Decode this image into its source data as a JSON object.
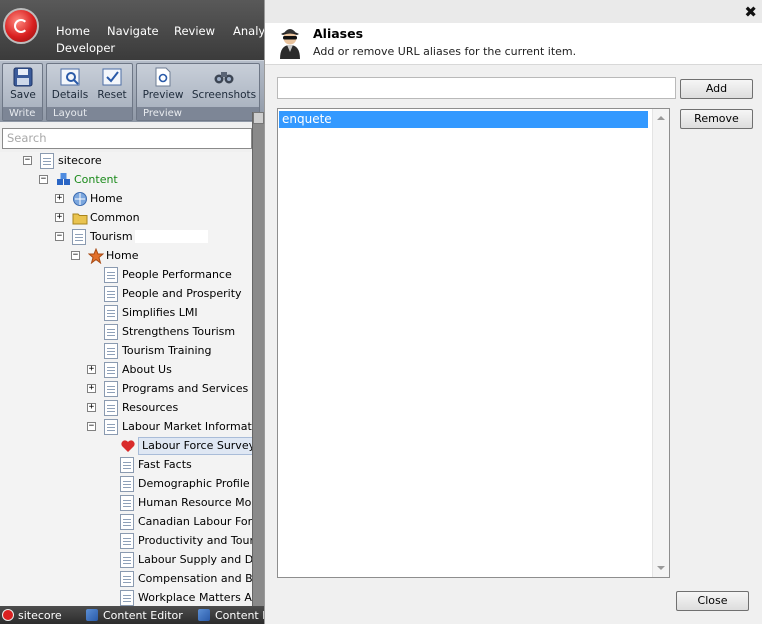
{
  "app": {
    "menu": [
      "Home",
      "Navigate",
      "Review",
      "Analy",
      "Developer"
    ],
    "ribbon": {
      "groups": [
        {
          "title": "Write",
          "buttons": [
            "Save"
          ]
        },
        {
          "title": "Layout",
          "buttons": [
            "Details",
            "Reset"
          ]
        },
        {
          "title": "Preview",
          "buttons": [
            "Preview",
            "Screenshots"
          ]
        }
      ]
    },
    "search_placeholder": "Search",
    "tree": [
      {
        "label": "sitecore",
        "level": 0,
        "toggle": "−",
        "icon": "doc"
      },
      {
        "label": "Content",
        "level": 1,
        "toggle": "−",
        "icon": "content",
        "color": "#1a8a1a"
      },
      {
        "label": "Home",
        "level": 2,
        "toggle": "+",
        "icon": "home"
      },
      {
        "label": "Common",
        "level": 2,
        "toggle": "+",
        "icon": "folder"
      },
      {
        "label": "Tourism",
        "level": 2,
        "toggle": "−",
        "icon": "doc"
      },
      {
        "label": "Home",
        "level": 3,
        "toggle": "−",
        "icon": "star"
      },
      {
        "label": "People Performance",
        "level": 4,
        "icon": "doc"
      },
      {
        "label": "People and Prosperity",
        "level": 4,
        "icon": "doc"
      },
      {
        "label": "Simplifies LMI",
        "level": 4,
        "icon": "doc"
      },
      {
        "label": "Strengthens Tourism",
        "level": 4,
        "icon": "doc"
      },
      {
        "label": "Tourism Training",
        "level": 4,
        "icon": "doc"
      },
      {
        "label": "About Us",
        "level": 4,
        "toggle": "+",
        "icon": "doc"
      },
      {
        "label": "Programs and Services",
        "level": 4,
        "toggle": "+",
        "icon": "doc"
      },
      {
        "label": "Resources",
        "level": 4,
        "toggle": "+",
        "icon": "doc"
      },
      {
        "label": "Labour Market Information",
        "level": 4,
        "toggle": "−",
        "icon": "doc"
      },
      {
        "label": "Labour Force Survey",
        "level": 5,
        "icon": "heart",
        "selected": true
      },
      {
        "label": "Fast Facts",
        "level": 5,
        "icon": "doc"
      },
      {
        "label": "Demographic Profile of",
        "level": 5,
        "icon": "doc"
      },
      {
        "label": "Human Resource Modu",
        "level": 5,
        "icon": "doc"
      },
      {
        "label": "Canadian Labour Force",
        "level": 5,
        "icon": "doc"
      },
      {
        "label": "Productivity and Touris",
        "level": 5,
        "icon": "doc"
      },
      {
        "label": "Labour Supply and Der",
        "level": 5,
        "icon": "doc"
      },
      {
        "label": "Compensation and Ber",
        "level": 5,
        "icon": "doc"
      },
      {
        "label": "Workplace Matters Adv",
        "level": 5,
        "icon": "doc"
      }
    ],
    "taskbar": {
      "start_label": "sitecore",
      "tasks": [
        "Content Editor",
        "Content E"
      ]
    }
  },
  "dialog": {
    "title": "Aliases",
    "subtitle": "Add or remove URL aliases for the current item.",
    "close_glyph": "✖",
    "input_value": "",
    "add_label": "Add",
    "remove_label": "Remove",
    "close_label": "Close",
    "aliases": [
      {
        "value": "enquete",
        "selected": true
      }
    ]
  },
  "colors": {
    "selection": "#3399ff",
    "content_node": "#1a8a1a"
  }
}
